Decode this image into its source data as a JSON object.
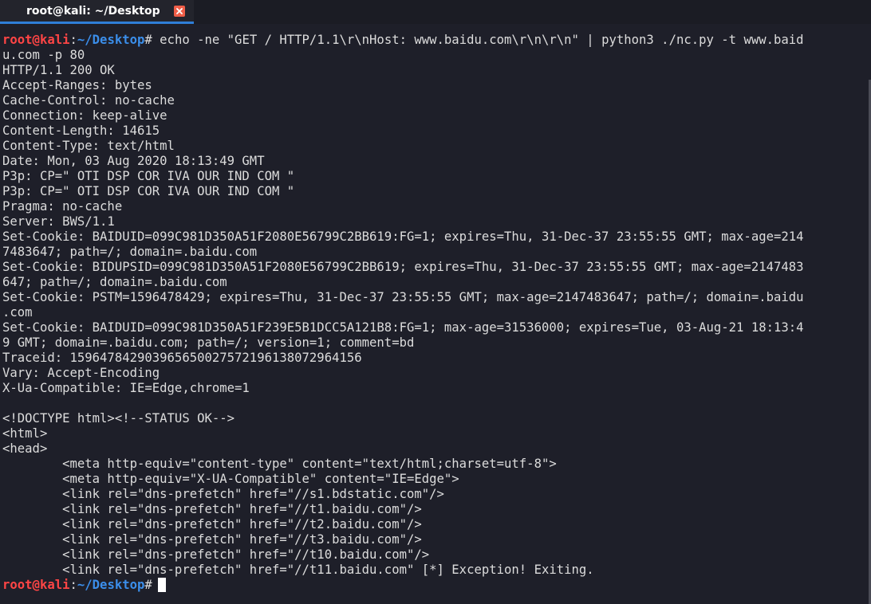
{
  "tab": {
    "title": "root@kali: ~/Desktop"
  },
  "prompt": {
    "user_host": "root@kali",
    "colon": ":",
    "path": "~/Desktop",
    "symbol": "#"
  },
  "command": " echo -ne \"GET / HTTP/1.1\\r\\nHost: www.baidu.com\\r\\n\\r\\n\" | python3 ./nc.py -t www.baid",
  "output_lines": [
    "u.com -p 80",
    "HTTP/1.1 200 OK",
    "Accept-Ranges: bytes",
    "Cache-Control: no-cache",
    "Connection: keep-alive",
    "Content-Length: 14615",
    "Content-Type: text/html",
    "Date: Mon, 03 Aug 2020 18:13:49 GMT",
    "P3p: CP=\" OTI DSP COR IVA OUR IND COM \"",
    "P3p: CP=\" OTI DSP COR IVA OUR IND COM \"",
    "Pragma: no-cache",
    "Server: BWS/1.1",
    "Set-Cookie: BAIDUID=099C981D350A51F2080E56799C2BB619:FG=1; expires=Thu, 31-Dec-37 23:55:55 GMT; max-age=214",
    "7483647; path=/; domain=.baidu.com",
    "Set-Cookie: BIDUPSID=099C981D350A51F2080E56799C2BB619; expires=Thu, 31-Dec-37 23:55:55 GMT; max-age=2147483",
    "647; path=/; domain=.baidu.com",
    "Set-Cookie: PSTM=1596478429; expires=Thu, 31-Dec-37 23:55:55 GMT; max-age=2147483647; path=/; domain=.baidu",
    ".com",
    "Set-Cookie: BAIDUID=099C981D350A51F239E5B1DCC5A121B8:FG=1; max-age=31536000; expires=Tue, 03-Aug-21 18:13:4",
    "9 GMT; domain=.baidu.com; path=/; version=1; comment=bd",
    "Traceid: 1596478429039656500275721961380729641​56",
    "Vary: Accept-Encoding",
    "X-Ua-Compatible: IE=Edge,chrome=1",
    "",
    "<!DOCTYPE html><!--STATUS OK-->",
    "<html>",
    "<head>",
    "        <meta http-equiv=\"content-type\" content=\"text/html;charset=utf-8\">",
    "        <meta http-equiv=\"X-UA-Compatible\" content=\"IE=Edge\">",
    "        <link rel=\"dns-prefetch\" href=\"//s1.bdstatic.com\"/>",
    "        <link rel=\"dns-prefetch\" href=\"//t1.baidu.com\"/>",
    "        <link rel=\"dns-prefetch\" href=\"//t2.baidu.com\"/>",
    "        <link rel=\"dns-prefetch\" href=\"//t3.baidu.com\"/>",
    "        <link rel=\"dns-prefetch\" href=\"//t10.baidu.com\"/>",
    "        <link rel=\"dns-prefetch\" href=\"//t11.baidu.com\" [*] Exception! Exiting."
  ],
  "colors": {
    "background": "#1e1f29",
    "text": "#dcdcdc",
    "prompt_user": "#ff4545",
    "prompt_path": "#3b8eea",
    "tab_accent": "#2f7fd8",
    "close_button": "#f05e48"
  }
}
